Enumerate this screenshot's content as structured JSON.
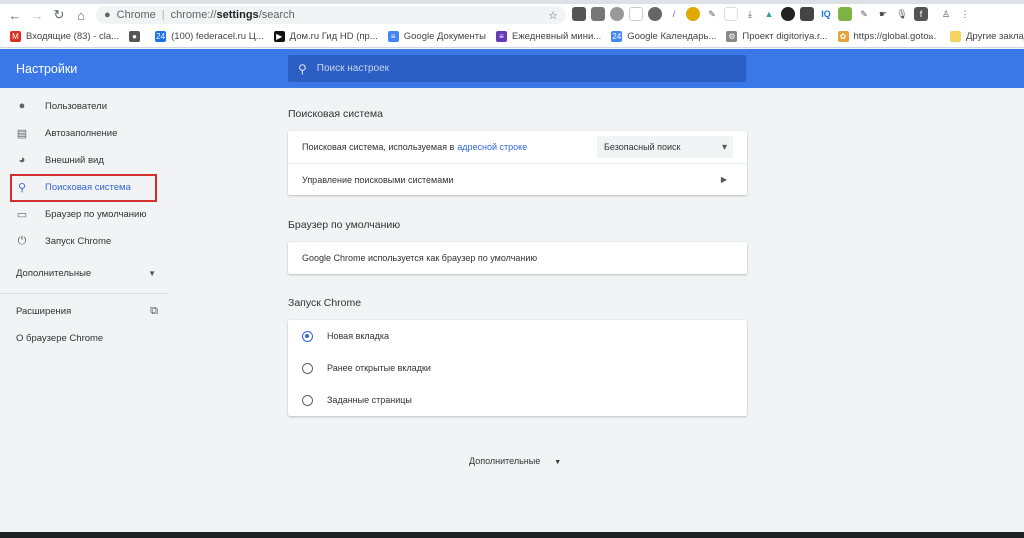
{
  "browser": {
    "omnibox": {
      "site": "Chrome",
      "url_prefix": "chrome://",
      "url_bold": "settings",
      "url_suffix": "/search"
    },
    "bookmarks": [
      {
        "label": "Входящие (83) - cla...",
        "icon": "gmail-icon",
        "color": "#d93025",
        "glyph": "M"
      },
      {
        "label": "",
        "icon": "globe-icon",
        "color": "#555",
        "glyph": "●"
      },
      {
        "label": "(100) federacel.ru Ц...",
        "icon": "24-icon",
        "color": "#1a73e8",
        "glyph": "24"
      },
      {
        "label": "Дом.ru Гид HD (пр...",
        "icon": "play-icon",
        "color": "#111",
        "glyph": "▶"
      },
      {
        "label": "Google Документы",
        "icon": "docs-icon",
        "color": "#4285f4",
        "glyph": "≡"
      },
      {
        "label": "Ежедневный мини...",
        "icon": "forms-icon",
        "color": "#673ab7",
        "glyph": "≡"
      },
      {
        "label": "Google Календарь...",
        "icon": "calendar-icon",
        "color": "#4285f4",
        "glyph": "24"
      },
      {
        "label": "Проект digitoriya.r...",
        "icon": "gear-icon",
        "color": "#888",
        "glyph": "⚙"
      },
      {
        "label": "https://global.goto...",
        "icon": "gotomeeting-icon",
        "color": "#e8a33d",
        "glyph": "✿"
      }
    ],
    "more_bookmarks": "»",
    "other_bookmarks": "Другие закладки"
  },
  "header": {
    "title": "Настройки",
    "search_placeholder": "Поиск настроек"
  },
  "sidebar": {
    "items": [
      {
        "label": "Пользователи",
        "icon": "person-icon",
        "glyph": "👤"
      },
      {
        "label": "Автозаполнение",
        "icon": "clipboard-icon",
        "glyph": "▤"
      },
      {
        "label": "Внешний вид",
        "icon": "palette-icon",
        "glyph": "◕"
      },
      {
        "label": "Поисковая система",
        "icon": "search-icon",
        "glyph": "⚲"
      },
      {
        "label": "Браузер по умолчанию",
        "icon": "browser-icon",
        "glyph": "▭"
      },
      {
        "label": "Запуск Chrome",
        "icon": "power-icon",
        "glyph": "⏻"
      }
    ],
    "advanced": "Дополнительные",
    "extensions": "Расширения",
    "about": "О браузере Chrome"
  },
  "main": {
    "search_engine": {
      "title": "Поисковая система",
      "used_in_text": "Поисковая система, используемая в",
      "used_in_link": "адресной строке",
      "selected": "Безопасный поиск",
      "manage": "Управление поисковыми системами"
    },
    "default_browser": {
      "title": "Браузер по умолчанию",
      "status": "Google Chrome используется как браузер по умолчанию"
    },
    "startup": {
      "title": "Запуск Chrome",
      "options": [
        {
          "label": "Новая вкладка",
          "selected": true
        },
        {
          "label": "Ранее открытые вкладки",
          "selected": false
        },
        {
          "label": "Заданные страницы",
          "selected": false
        }
      ]
    },
    "advanced": "Дополнительные"
  }
}
